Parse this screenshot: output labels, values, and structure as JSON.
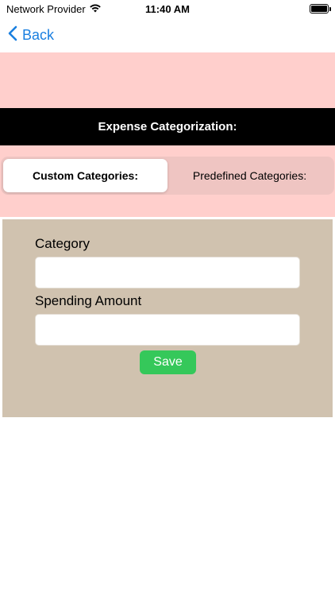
{
  "status_bar": {
    "carrier": "Network Provider",
    "time": "11:40 AM",
    "icons": [
      "wifi-icon",
      "battery-icon"
    ]
  },
  "nav": {
    "back_label": "Back",
    "back_icon": "chevron-left-icon"
  },
  "header": {
    "title": "Expense Categorization:"
  },
  "segments": {
    "items": [
      {
        "label": "Custom Categories:",
        "selected": true
      },
      {
        "label": "Predefined Categories:",
        "selected": false
      }
    ]
  },
  "form": {
    "category_label": "Category",
    "category_value": "",
    "category_placeholder": "",
    "amount_label": "Spending Amount",
    "amount_value": "",
    "amount_placeholder": "",
    "save_label": "Save"
  },
  "colors": {
    "accent": "#1a7fe0",
    "pink_background": "#ffcfcc",
    "segment_track": "#efc5c2",
    "form_background": "#d0c2af",
    "save_button": "#35c85a",
    "title_bar": "#000000"
  }
}
